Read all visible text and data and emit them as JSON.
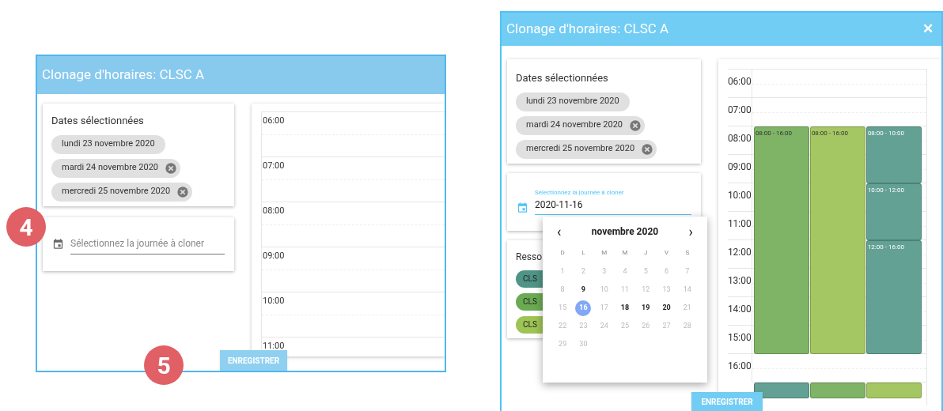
{
  "step_markers": [
    {
      "label": "4"
    },
    {
      "label": "5"
    }
  ],
  "dialog_before": {
    "title": "Clonage d'horaires: CLSC A",
    "dates_card": {
      "title": "Dates sélectionnées",
      "chips": [
        {
          "label": "lundi 23 novembre 2020",
          "removable": false
        },
        {
          "label": "mardi 24 novembre 2020",
          "removable": true
        },
        {
          "label": "mercredi 25 novembre 2020",
          "removable": true
        }
      ]
    },
    "day_field": {
      "placeholder": "Sélectionnez la journée à cloner"
    },
    "schedule": {
      "times": [
        "06:00",
        "07:00",
        "08:00",
        "09:00",
        "10:00",
        "11:00"
      ]
    },
    "save_button": "ENREGISTRER"
  },
  "dialog_after": {
    "title": "Clonage d'horaires: CLSC A",
    "close": "✕",
    "dates_card": {
      "title": "Dates sélectionnées",
      "chips": [
        {
          "label": "lundi 23 novembre 2020",
          "removable": false
        },
        {
          "label": "mardi 24 novembre 2020",
          "removable": true
        },
        {
          "label": "mercredi 25 novembre 2020",
          "removable": true
        }
      ]
    },
    "day_field": {
      "label": "Sélectionnez la journée à cloner",
      "value": "2020-11-16"
    },
    "resources_card": {
      "title": "Resso",
      "chips": [
        {
          "label": "CLS",
          "color": "#4f9486"
        },
        {
          "label": "CLS",
          "color": "#6aaa52"
        },
        {
          "label": "CLS",
          "color": "#9dc454"
        }
      ]
    },
    "date_picker": {
      "prev": "‹",
      "next": "›",
      "month": "novembre 2020",
      "weekdays": [
        "D",
        "L",
        "M",
        "M",
        "J",
        "V",
        "S"
      ],
      "days": [
        {
          "label": "1",
          "available": false,
          "selected": false
        },
        {
          "label": "2",
          "available": false,
          "selected": false
        },
        {
          "label": "3",
          "available": false,
          "selected": false
        },
        {
          "label": "4",
          "available": false,
          "selected": false
        },
        {
          "label": "5",
          "available": false,
          "selected": false
        },
        {
          "label": "6",
          "available": false,
          "selected": false
        },
        {
          "label": "7",
          "available": false,
          "selected": false
        },
        {
          "label": "8",
          "available": false,
          "selected": false
        },
        {
          "label": "9",
          "available": true,
          "selected": false
        },
        {
          "label": "10",
          "available": false,
          "selected": false
        },
        {
          "label": "11",
          "available": false,
          "selected": false
        },
        {
          "label": "12",
          "available": false,
          "selected": false
        },
        {
          "label": "13",
          "available": false,
          "selected": false
        },
        {
          "label": "14",
          "available": false,
          "selected": false
        },
        {
          "label": "15",
          "available": false,
          "selected": false
        },
        {
          "label": "16",
          "available": true,
          "selected": true
        },
        {
          "label": "17",
          "available": false,
          "selected": false
        },
        {
          "label": "18",
          "available": true,
          "selected": false
        },
        {
          "label": "19",
          "available": true,
          "selected": false
        },
        {
          "label": "20",
          "available": true,
          "selected": false
        },
        {
          "label": "21",
          "available": false,
          "selected": false
        },
        {
          "label": "22",
          "available": false,
          "selected": false
        },
        {
          "label": "23",
          "available": false,
          "selected": false
        },
        {
          "label": "24",
          "available": false,
          "selected": false
        },
        {
          "label": "25",
          "available": false,
          "selected": false
        },
        {
          "label": "26",
          "available": false,
          "selected": false
        },
        {
          "label": "27",
          "available": false,
          "selected": false
        },
        {
          "label": "28",
          "available": false,
          "selected": false
        },
        {
          "label": "29",
          "available": false,
          "selected": false
        },
        {
          "label": "30",
          "available": false,
          "selected": false
        }
      ]
    },
    "schedule": {
      "times": [
        "06:00",
        "07:00",
        "08:00",
        "09:00",
        "10:00",
        "11:00",
        "12:00",
        "13:00",
        "14:00",
        "15:00",
        "16:00"
      ],
      "columns": [
        {
          "events": [
            {
              "kind": "block",
              "label": "08:00 - 16:00",
              "color": "#7fb467"
            },
            {
              "kind": "partial",
              "color": "#62a194"
            }
          ]
        },
        {
          "events": [
            {
              "kind": "block",
              "label": "08:00 - 16:00",
              "color": "#a5c763"
            },
            {
              "kind": "partial",
              "color": "#7fb467"
            }
          ]
        },
        {
          "events": [
            {
              "kind": "block",
              "label": "08:00 - 10:00",
              "color": "#62a194"
            },
            {
              "kind": "block",
              "label": "10:00 - 12:00",
              "color": "#62a194"
            },
            {
              "kind": "block",
              "label": "12:00 - 16:00",
              "color": "#62a194"
            },
            {
              "kind": "partial",
              "color": "#a5c763"
            }
          ]
        }
      ]
    },
    "save_button": "ENREGISTRER"
  }
}
